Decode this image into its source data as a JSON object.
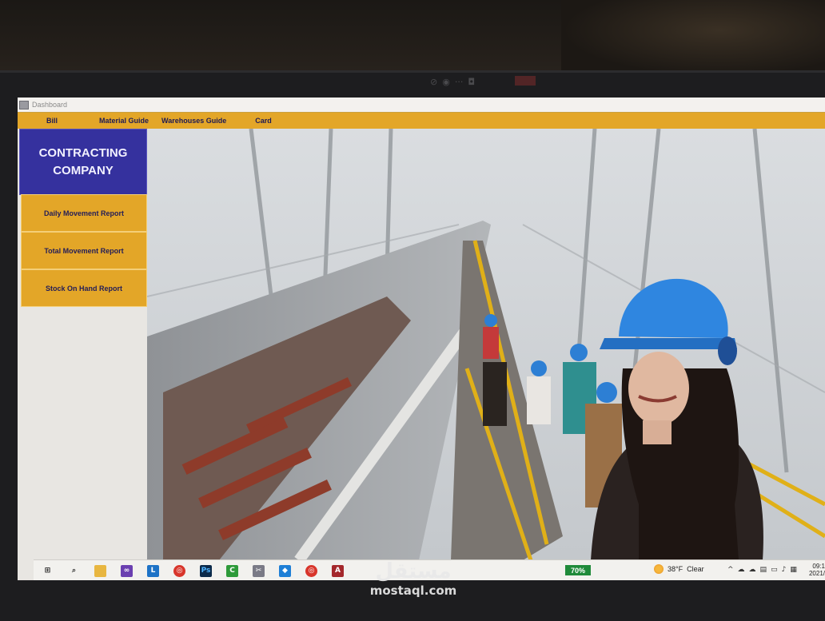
{
  "window": {
    "title": "Dashboard",
    "icon": "access-form-icon"
  },
  "menu": {
    "items": [
      {
        "label": "Bill"
      },
      {
        "label": "Material Guide"
      },
      {
        "label": "Warehouses Guide"
      },
      {
        "label": "Card"
      }
    ]
  },
  "sidebar": {
    "company_line1": "CONTRACTING",
    "company_line2": "COMPANY",
    "buttons": [
      {
        "label": "Daily Movement Report"
      },
      {
        "label": "Total Movement Report"
      },
      {
        "label": "Stock On Hand Report"
      }
    ]
  },
  "hero": {
    "description_icon": "construction-worker-photo"
  },
  "taskbar": {
    "battery": "70%",
    "temperature": "38°F",
    "weather": "Clear",
    "time": "09:1",
    "date": "2021/"
  },
  "watermark": {
    "arabic": "مستقل",
    "latin": "mostaql.com"
  },
  "colors": {
    "menu_bar": "#e3a628",
    "company_panel": "#35319e",
    "nav_button": "#e3a628",
    "side_panel": "#3532a6"
  }
}
